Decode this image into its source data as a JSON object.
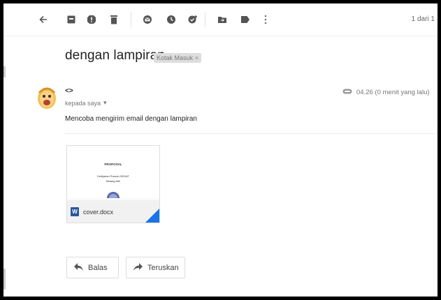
{
  "toolbar": {
    "icons": [
      "back-arrow-icon",
      "archive-icon",
      "report-spam-icon",
      "delete-icon",
      "mark-unread-icon",
      "snooze-icon",
      "add-to-tasks-icon",
      "move-to-icon",
      "labels-icon",
      "more-vert-icon"
    ],
    "pager": "1 dari 1"
  },
  "message": {
    "subject": "dengan lampiran",
    "label": "Kotak Masuk",
    "label_close": "×",
    "sender": "<>",
    "to_text": "kepada saya",
    "to_caret": "▾",
    "time": "04.26 (0 menit yang lalu)",
    "body": "Mencoba mengirim email dengan lampiran"
  },
  "attachment": {
    "file_name": "cover.docx",
    "file_badge": "W",
    "preview_title": "PROPOSAL",
    "preview_line1": "Kebijakan Rumah SEHAT",
    "preview_line2": "Bidang Ahli"
  },
  "actions": {
    "reply": "Balas",
    "forward": "Teruskan"
  },
  "colors": {
    "accent": "#1a73e8",
    "word": "#2b579a",
    "label_bg": "#dddddd"
  }
}
